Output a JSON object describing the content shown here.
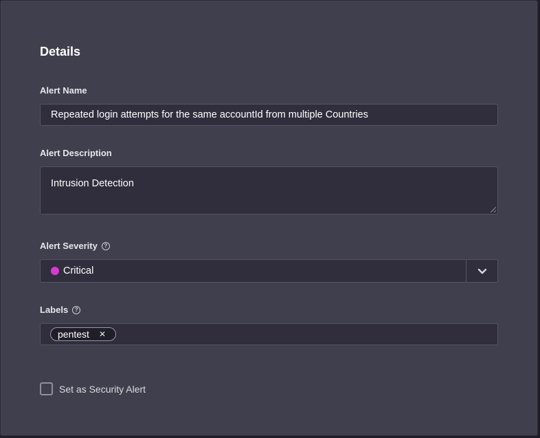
{
  "details": {
    "title": "Details",
    "alert_name": {
      "label": "Alert Name",
      "value": "Repeated login attempts for the same accountId from multiple Countries"
    },
    "alert_description": {
      "label": "Alert Description",
      "value": "Intrusion Detection"
    },
    "alert_severity": {
      "label": "Alert Severity",
      "help_icon": "help-circle-icon",
      "value": "Critical",
      "dot_color": "#d63ad0",
      "dropdown_icon": "chevron-down-icon"
    },
    "labels": {
      "label": "Labels",
      "help_icon": "help-circle-icon",
      "chips": [
        {
          "text": "pentest",
          "remove_icon": "close-icon"
        }
      ]
    },
    "security_alert": {
      "label": "Set as Security Alert",
      "checked": false
    }
  },
  "colors": {
    "panel_bg": "#403f4d",
    "field_bg": "#302e3c",
    "critical": "#d63ad0"
  }
}
